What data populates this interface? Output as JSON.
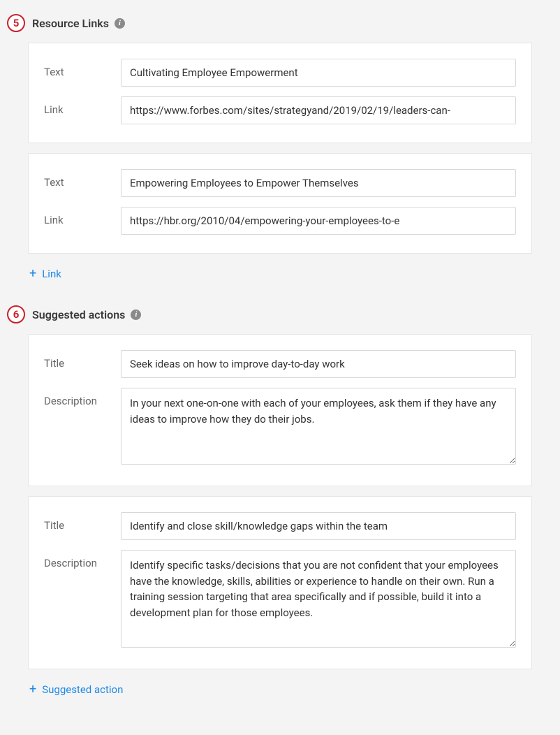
{
  "sections": {
    "resourceLinks": {
      "number": "5",
      "title": "Resource Links",
      "labels": {
        "text": "Text",
        "link": "Link"
      },
      "items": [
        {
          "text": "Cultivating Employee Empowerment",
          "link": "https://www.forbes.com/sites/strategyand/2019/02/19/leaders-can-"
        },
        {
          "text": "Empowering Employees to Empower Themselves",
          "link": "https://hbr.org/2010/04/empowering-your-employees-to-e"
        }
      ],
      "addLabel": "Link"
    },
    "suggestedActions": {
      "number": "6",
      "title": "Suggested actions",
      "labels": {
        "title": "Title",
        "description": "Description"
      },
      "items": [
        {
          "title": "Seek ideas on how to improve day-to-day work",
          "description": "In your next one-on-one with each of your employees, ask them if they have any ideas to improve how they do their jobs."
        },
        {
          "title": "Identify and close skill/knowledge gaps within the team",
          "description": "Identify specific tasks/decisions that you are not confident that your employees have the knowledge, skills, abilities or experience to handle on their own. Run a training session targeting that area specifically and if possible, build it into a development plan for those employees."
        }
      ],
      "addLabel": "Suggested action"
    }
  }
}
